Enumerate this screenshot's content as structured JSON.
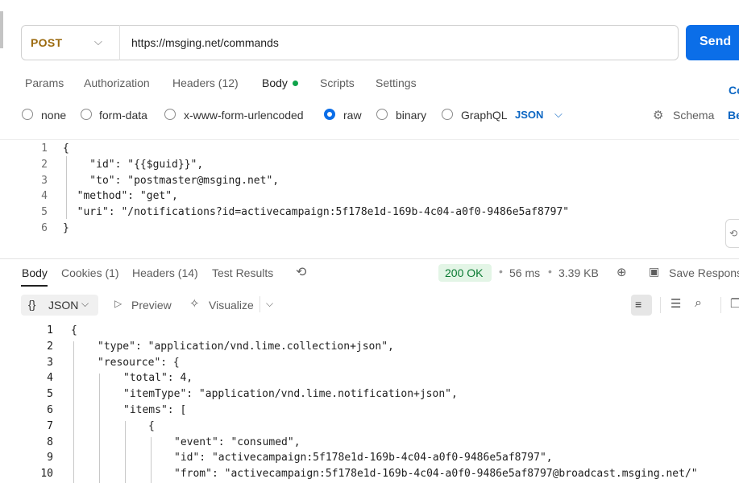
{
  "request": {
    "method": "POST",
    "url": "https://msging.net/commands",
    "send_label": "Send"
  },
  "request_tabs": [
    {
      "label": "Params"
    },
    {
      "label": "Authorization"
    },
    {
      "label": "Headers (12)"
    },
    {
      "label": "Body"
    },
    {
      "label": "Scripts"
    },
    {
      "label": "Settings"
    }
  ],
  "cookies_link_partial": "Co",
  "body_types": [
    {
      "label": "none"
    },
    {
      "label": "form-data"
    },
    {
      "label": "x-www-form-urlencoded"
    },
    {
      "label": "raw"
    },
    {
      "label": "binary"
    },
    {
      "label": "GraphQL"
    }
  ],
  "body_format": "JSON",
  "schema_label": "Schema",
  "beautify_partial": "Be",
  "request_body": {
    "line_numbers": [
      "1",
      "2",
      "3",
      "4",
      "5",
      "6"
    ],
    "lines": [
      "{",
      "    \"id\": \"{{$guid}}\",",
      "    \"to\": \"postmaster@msging.net\",",
      "  \"method\": \"get\",",
      "  \"uri\": \"/notifications?id=activecampaign:5f178e1d-169b-4c04-a0f0-9486e5af8797\"",
      "}"
    ]
  },
  "response_tabs": [
    {
      "label": "Body"
    },
    {
      "label": "Cookies (1)"
    },
    {
      "label": "Headers (14)"
    },
    {
      "label": "Test Results"
    }
  ],
  "response_meta": {
    "status": "200 OK",
    "time": "56 ms",
    "size": "3.39 KB",
    "save_label": "Save Response"
  },
  "response_toolbar": {
    "format": "JSON",
    "preview": "Preview",
    "visualize": "Visualize"
  },
  "response_body": {
    "line_numbers": [
      "1",
      "2",
      "3",
      "4",
      "5",
      "6",
      "7",
      "8",
      "9",
      "10"
    ],
    "lines": [
      "{",
      "\"type\": \"application/vnd.lime.collection+json\",",
      "\"resource\": {",
      "\"total\": 4,",
      "\"itemType\": \"application/vnd.lime.notification+json\",",
      "\"items\": [",
      "{",
      "\"event\": \"consumed\",",
      "\"id\": \"activecampaign:5f178e1d-169b-4c04-a0f0-9486e5af8797\",",
      "\"from\": \"activecampaign:5f178e1d-169b-4c04-a0f0-9486e5af8797@broadcast.msging.net/\""
    ]
  },
  "colors": {
    "accent": "#0b6ee8",
    "method": "#9b6a0f",
    "status_bg": "#e3f5e6",
    "status_text": "#0a7a32",
    "json_key": "#a31515",
    "json_string": "#0451a5"
  }
}
